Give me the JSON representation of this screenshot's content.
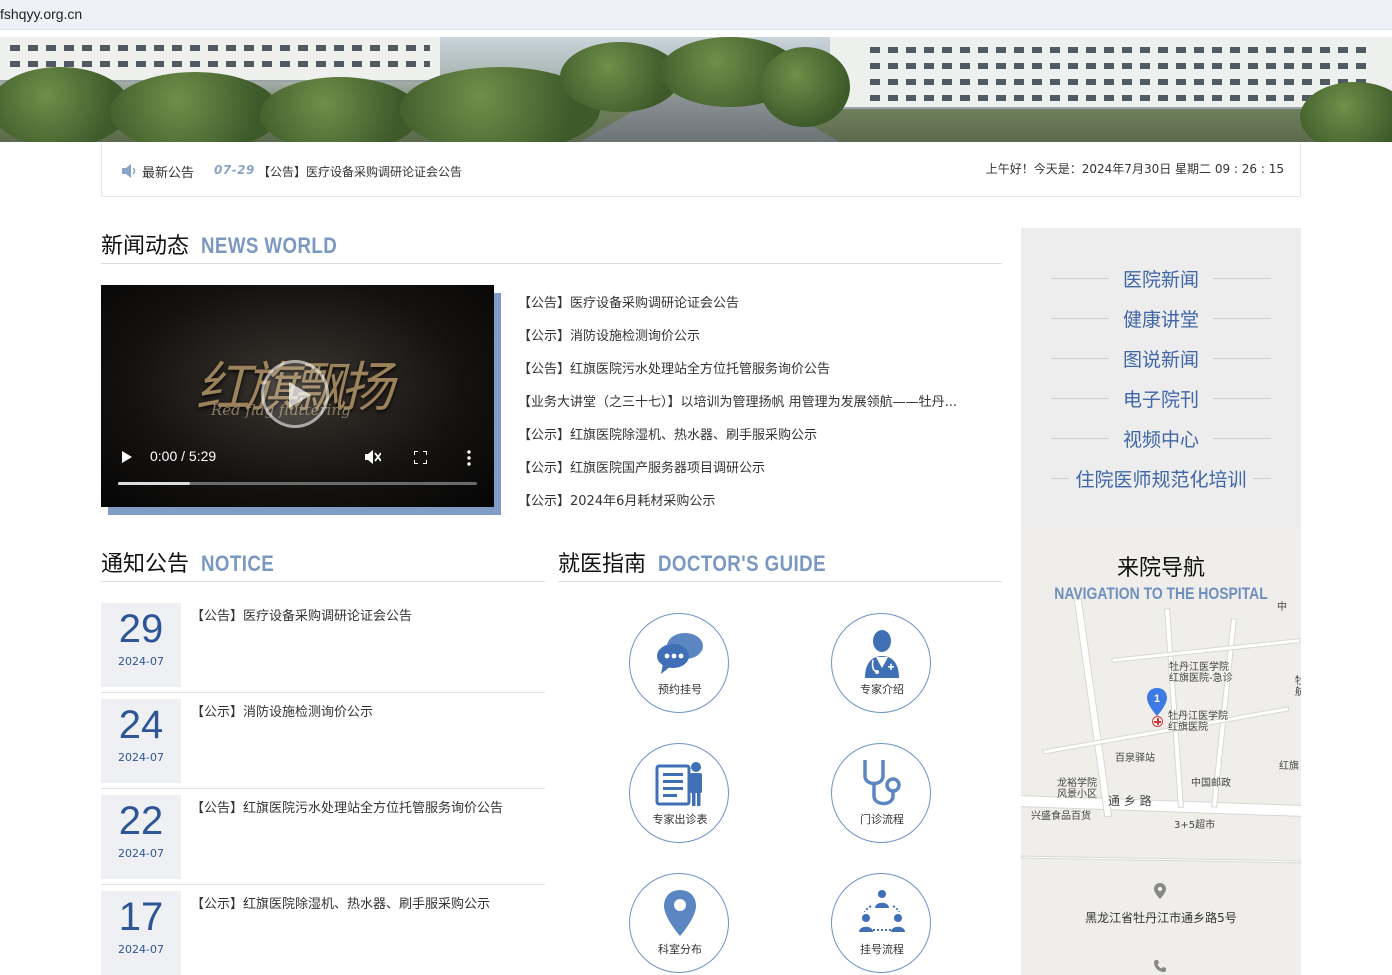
{
  "browser": {
    "url": "fshqyy.org.cn"
  },
  "notice_bar": {
    "label": "最新公告",
    "date": "07-29",
    "title": "【公告】医疗设备采购调研论证会公告",
    "greeting": "上午好！今天是：2024年7月30日 星期二 09 : 26 : 15"
  },
  "news": {
    "title_cn": "新闻动态",
    "title_en": "NEWS WORLD",
    "video": {
      "calligraphy": "红旗飘扬",
      "subtitle": "Red flag fluttering",
      "time": "0:00 / 5:29",
      "progress": 0.2
    },
    "items": [
      "【公告】医疗设备采购调研论证会公告",
      "【公示】消防设施检测询价公示",
      "【公告】红旗医院污水处理站全方位托管服务询价公告",
      "【业务大讲堂（之三十七）】以培训为管理扬帆 用管理为发展领航——牡丹...",
      "【公示】红旗医院除湿机、热水器、刷手服采购公示",
      "【公示】红旗医院国产服务器项目调研公示",
      "【公示】2024年6月耗材采购公示"
    ]
  },
  "sidebar": {
    "items": [
      "医院新闻",
      "健康讲堂",
      "图说新闻",
      "电子院刊",
      "视频中心",
      "住院医师规范化培训"
    ]
  },
  "map": {
    "title": "来院导航",
    "subtitle": "NAVIGATION TO THE HOSPITAL",
    "pin_number": "1",
    "labels": {
      "emergency": "牡丹江医学院\n红旗医院-急诊",
      "hospital": "牡丹江医学院\n红旗医院",
      "baiquan": "百泉驿站",
      "longyu": "龙裕学院\n风景小区",
      "road": "通 乡 路",
      "xingsheng": "兴盛食品百货",
      "post": "中国邮政",
      "market": "3+5超市",
      "hongqi_right": "红旗",
      "zhong": "中",
      "mu": "牡\n航"
    },
    "address": "黑龙江省牡丹江市通乡路5号"
  },
  "notices": {
    "title_cn": "通知公告",
    "title_en": "NOTICE",
    "items": [
      {
        "day": "29",
        "ym": "2024-07",
        "title": "【公告】医疗设备采购调研论证会公告"
      },
      {
        "day": "24",
        "ym": "2024-07",
        "title": "【公示】消防设施检测询价公示"
      },
      {
        "day": "22",
        "ym": "2024-07",
        "title": "【公告】红旗医院污水处理站全方位托管服务询价公告"
      },
      {
        "day": "17",
        "ym": "2024-07",
        "title": "【公示】红旗医院除湿机、热水器、刷手服采购公示"
      }
    ]
  },
  "guide": {
    "title_cn": "就医指南",
    "title_en": "DOCTOR'S GUIDE",
    "items": [
      {
        "label": "预约挂号",
        "icon": "chat-bubbles-icon"
      },
      {
        "label": "专家介绍",
        "icon": "doctor-icon"
      },
      {
        "label": "专家出诊表",
        "icon": "schedule-board-icon"
      },
      {
        "label": "门诊流程",
        "icon": "stethoscope-icon"
      },
      {
        "label": "科室分布",
        "icon": "location-pin-icon"
      },
      {
        "label": "挂号流程",
        "icon": "people-flow-icon"
      }
    ]
  },
  "colors": {
    "accent": "#2d5597",
    "accent_light": "#7a99c2",
    "sidebar_bg": "#ededed"
  }
}
